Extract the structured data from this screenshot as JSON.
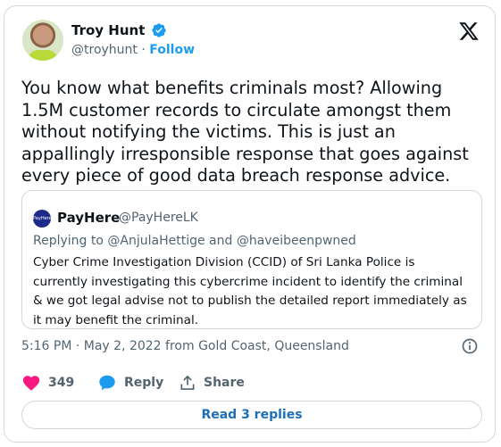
{
  "author": {
    "name": "Troy Hunt",
    "handle": "@troyhunt",
    "separator": "·",
    "follow_label": "Follow"
  },
  "tweet": {
    "text": "You know what benefits criminals most? Allowing 1.5M customer records to circulate amongst them without notifying the victims. This is just an appallingly irresponsible response that goes against every piece of good data breach response advice."
  },
  "quote": {
    "avatar_text": "PayHere",
    "name": "PayHere",
    "handle": "@PayHereLK",
    "replying_prefix": "Replying to",
    "mention_1": "@AnjulaHettige",
    "and_word": "and",
    "mention_2": "@haveibeenpwned",
    "text": "Cyber Crime Investigation Division (CCID) of Sri Lanka Police is currently investigating this cybercrime incident to identify the criminal & we got legal advise not to publish the detailed report immediately as it may benefit the criminal."
  },
  "meta": {
    "timestamp": "5:16 PM · May 2, 2022 from Gold Coast, Queensland"
  },
  "actions": {
    "like_count": "349",
    "reply_label": "Reply",
    "share_label": "Share"
  },
  "footer": {
    "read_replies_label": "Read 3 replies"
  },
  "colors": {
    "accent": "#1d9bf0",
    "like": "#f91880",
    "muted": "#536471",
    "border": "#cfd9de"
  },
  "icons": [
    "verified-badge-icon",
    "x-logo-icon",
    "info-icon",
    "heart-icon",
    "reply-bubble-icon",
    "share-icon"
  ]
}
